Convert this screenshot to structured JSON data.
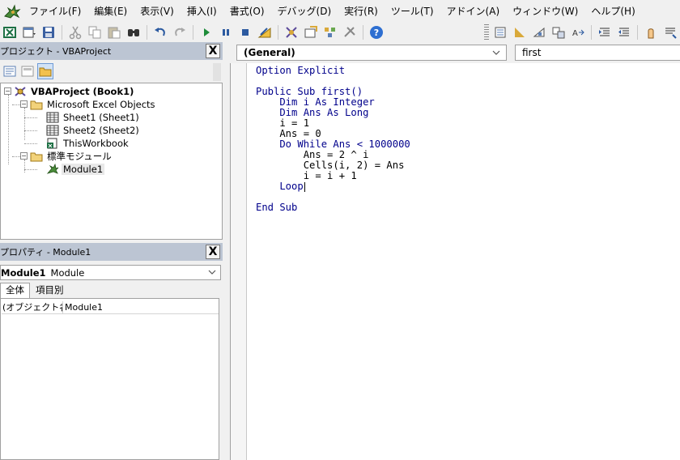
{
  "menubar": {
    "items": [
      "ファイル(F)",
      "編集(E)",
      "表示(V)",
      "挿入(I)",
      "書式(O)",
      "デバッグ(D)",
      "実行(R)",
      "ツール(T)",
      "アドイン(A)",
      "ウィンドウ(W)",
      "ヘルプ(H)"
    ]
  },
  "toolbar": {
    "icons": [
      "excel-icon",
      "insert-module-icon",
      "save-icon",
      "cut-icon",
      "copy-icon",
      "paste-icon",
      "find-icon",
      "undo-icon",
      "redo-icon",
      "run-icon",
      "break-icon",
      "reset-icon",
      "design-mode-icon",
      "project-explorer-icon",
      "properties-icon",
      "object-browser-icon",
      "toolbox-icon",
      "help-icon"
    ]
  },
  "project_panel": {
    "title": "プロジェクト - VBAProject",
    "close_label": "X",
    "tree": [
      {
        "label": "VBAProject (Book1)",
        "level": 0,
        "icon": "vbaproject-icon",
        "expanded": true
      },
      {
        "label": "Microsoft Excel Objects",
        "level": 1,
        "icon": "folder-icon",
        "expanded": true
      },
      {
        "label": "Sheet1 (Sheet1)",
        "level": 2,
        "icon": "sheet-icon"
      },
      {
        "label": "Sheet2 (Sheet2)",
        "level": 2,
        "icon": "sheet-icon"
      },
      {
        "label": "ThisWorkbook",
        "level": 2,
        "icon": "workbook-icon"
      },
      {
        "label": "標準モジュール",
        "level": 1,
        "icon": "folder-icon",
        "expanded": true
      },
      {
        "label": "Module1",
        "level": 2,
        "icon": "module-icon",
        "selected": true
      }
    ]
  },
  "properties_panel": {
    "title": "プロパティ - Module1",
    "close_label": "X",
    "object_name": "Module1",
    "object_type": "Module",
    "tabs": [
      "全体",
      "項目別"
    ],
    "active_tab": "全体",
    "rows": [
      {
        "key": "(オブジェクト名)",
        "value": "Module1"
      }
    ]
  },
  "code_window": {
    "object_combo": "(General)",
    "procedure_combo": "first",
    "lines": [
      {
        "text": "Option Explicit",
        "type": "kw"
      },
      {
        "text": "",
        "type": "plain"
      },
      {
        "text": "Public Sub first()",
        "type": "kw"
      },
      {
        "text": "    Dim i As Integer",
        "type": "kw"
      },
      {
        "text": "    Dim Ans As Long",
        "type": "kw"
      },
      {
        "text": "    i = 1",
        "type": "plain"
      },
      {
        "text": "    Ans = 0",
        "type": "plain"
      },
      {
        "text": "    Do While Ans < 1000000",
        "type": "kw"
      },
      {
        "text": "        Ans = 2 ^ i",
        "type": "plain"
      },
      {
        "text": "        Cells(i, 2) = Ans",
        "type": "plain"
      },
      {
        "text": "        i = i + 1",
        "type": "plain"
      },
      {
        "text": "    Loop",
        "type": "kw",
        "caret": true
      },
      {
        "text": "",
        "type": "plain"
      },
      {
        "text": "End Sub",
        "type": "kw"
      }
    ]
  },
  "colors": {
    "panel_header": "#bcc5d3",
    "keyword": "#00008b",
    "help_blue": "#2e6fd1"
  }
}
